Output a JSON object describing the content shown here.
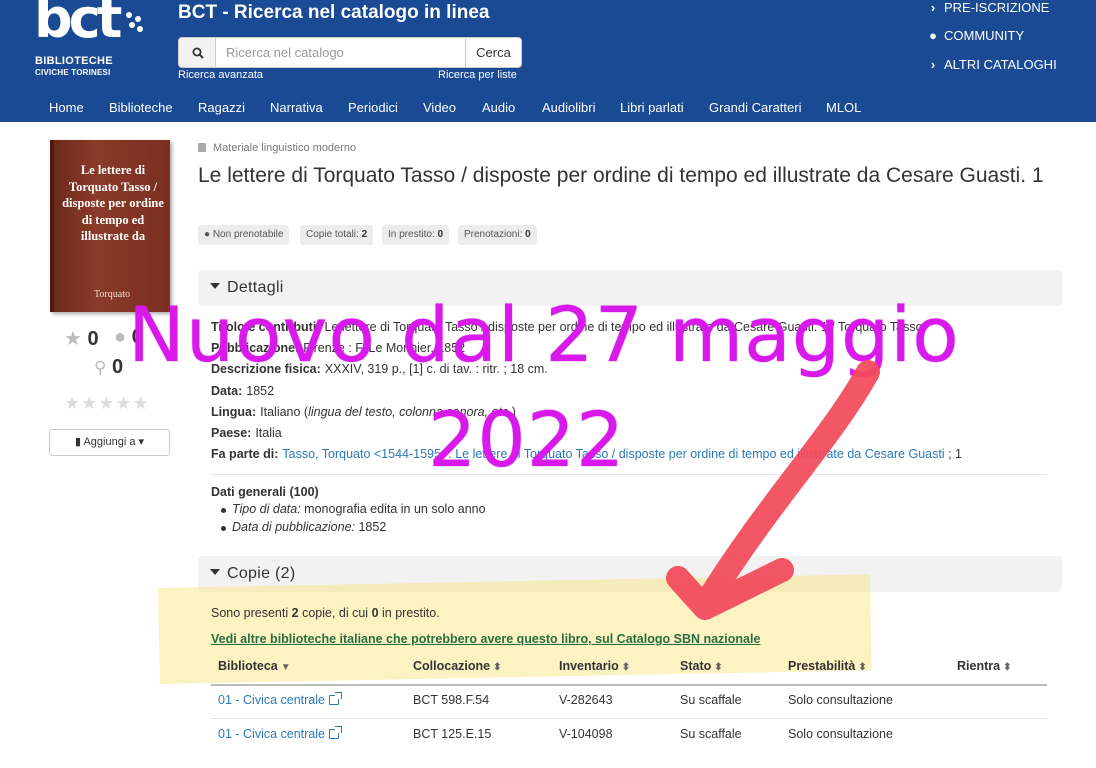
{
  "header": {
    "logo_mark": "bct",
    "logo_line1": "BIBLIOTECHE",
    "logo_line2": "CIVICHE TORINESI",
    "title": "BCT - Ricerca nel catalogo in linea",
    "search_placeholder": "Ricerca nel catalogo",
    "search_button": "Cerca",
    "advanced_search": "Ricerca avanzata",
    "list_search": "Ricerca per liste",
    "top_links": [
      {
        "icon": "chevron-right-icon",
        "label": "PRE-ISCRIZIONE"
      },
      {
        "icon": "comments-icon",
        "label": "COMMUNITY"
      },
      {
        "icon": "chevron-right-icon",
        "label": "ALTRI CATALOGHI"
      }
    ],
    "nav": [
      "Home",
      "Biblioteche",
      "Ragazzi",
      "Narrativa",
      "Periodici",
      "Video",
      "Audio",
      "Audiolibri",
      "Libri parlati",
      "Grandi Caratteri",
      "MLOL"
    ]
  },
  "sidebar": {
    "cover_title": "Le lettere di Torquato Tasso / disposte per ordine di tempo ed illustrate da",
    "cover_author": "Torquato",
    "stars_count": "0",
    "comments_count": "0",
    "places_count": "0",
    "rating_stars": 5,
    "add_to_label": "Aggiungi a"
  },
  "record": {
    "material": "Materiale linguistico moderno",
    "title": "Le lettere di Torquato Tasso / disposte per ordine di tempo ed illustrate da Cesare Guasti. 1",
    "badges": {
      "not_reservable": "Non prenotabile",
      "copies_label": "Copie totali:",
      "copies_value": "2",
      "loan_label": "In prestito:",
      "loan_value": "0",
      "reservations_label": "Prenotazioni:",
      "reservations_value": "0"
    }
  },
  "details": {
    "heading": "Dettagli",
    "rows": [
      {
        "label": "Titolo e contributi:",
        "value": "Le lettere di Torquato Tasso / disposte per ordine di tempo ed illustrate da Cesare Guasti. 1 / Torquato Tasso"
      },
      {
        "label": "Pubblicazione:",
        "value": "Firenze : F. Le Monnier, 1852"
      },
      {
        "label": "Descrizione fisica:",
        "value": "XXXIV, 319 p., [1] c. di tav. : ritr. ; 18 cm."
      },
      {
        "label": "Data:",
        "value": "1852"
      },
      {
        "label": "Lingua:",
        "value": "Italiano",
        "note": "lingua del testo, colonna sonora, etc."
      },
      {
        "label": "Paese:",
        "value": "Italia"
      },
      {
        "label": "Fa parte di:",
        "value": "Tasso, Torquato <1544-1595>. Le lettere di Torquato Tasso / disposte per ordine di tempo ed illustrate da Cesare Guasti",
        "suffix": "; 1"
      }
    ],
    "general_heading": "Dati generali (100)",
    "general_items": [
      {
        "label": "Tipo di data:",
        "value": "monografia edita in un solo anno"
      },
      {
        "label": "Data di pubblicazione:",
        "value": "1852"
      }
    ]
  },
  "copies": {
    "heading": "Copie (2)",
    "summary_pre": "Sono presenti",
    "summary_count": "2",
    "summary_mid": "copie, di cui",
    "summary_loan": "0",
    "summary_post": "in prestito.",
    "sbn_link": "Vedi altre biblioteche italiane che potrebbero avere questo libro, sul Catalogo SBN nazionale",
    "columns": [
      "Biblioteca",
      "Collocazione",
      "Inventario",
      "Stato",
      "Prestabilità",
      "Rientra"
    ],
    "rows": [
      {
        "library": "01 - Civica centrale",
        "location": "BCT 598.F.54",
        "inventory": "V-282643",
        "status": "Su scaffale",
        "loan": "Solo consultazione",
        "return": ""
      },
      {
        "library": "01 - Civica centrale",
        "location": "BCT 125.E.15",
        "inventory": "V-104098",
        "status": "Su scaffale",
        "loan": "Solo consultazione",
        "return": ""
      }
    ]
  },
  "annotation": {
    "line1": "Nuovo dal 27 maggio",
    "line2": "2022",
    "color": "#d918ec",
    "arrow_color": "#f24a5a",
    "highlight_color": "#fae278"
  }
}
